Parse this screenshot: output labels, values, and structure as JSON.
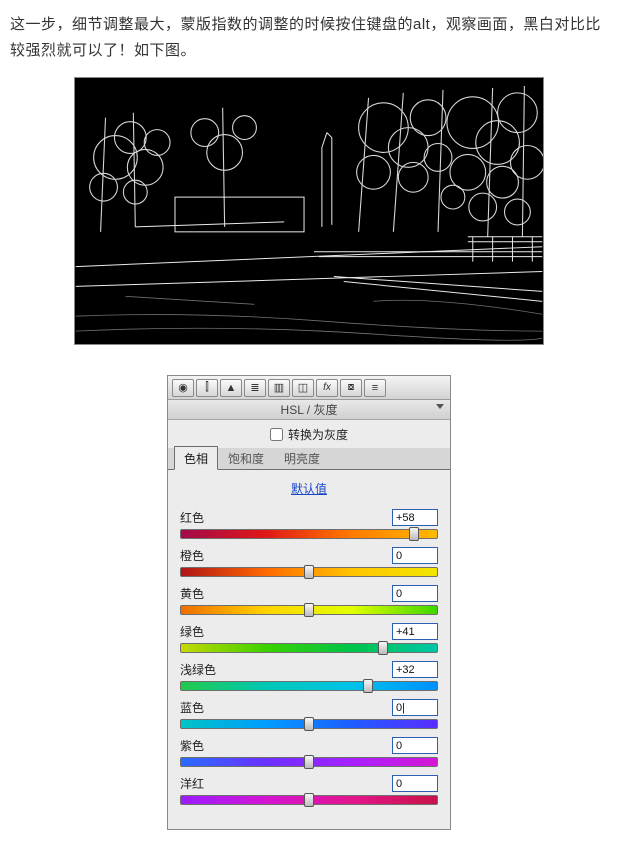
{
  "intro_text": "这一步，细节调整最大，蒙版指数的调整的时候按住键盘的alt，观察画面，黑白对比比较强烈就可以了！如下图。",
  "panel": {
    "title": "HSL / 灰度",
    "grayscale_label": "转换为灰度",
    "tabs": {
      "hue": "色相",
      "saturation": "饱和度",
      "luminance": "明亮度"
    },
    "default_link": "默认值",
    "toolbar_icons": [
      "aperture",
      "histogram",
      "triangle",
      "lines",
      "split",
      "crop",
      "fx",
      "camera",
      "sliders"
    ],
    "sliders": [
      {
        "label": "红色",
        "value": "+58",
        "grad": "g-red",
        "thumb_pct": 91
      },
      {
        "label": "橙色",
        "value": "0",
        "grad": "g-orange",
        "thumb_pct": 50
      },
      {
        "label": "黄色",
        "value": "0",
        "grad": "g-yellow",
        "thumb_pct": 50
      },
      {
        "label": "绿色",
        "value": "+41",
        "grad": "g-green",
        "thumb_pct": 79
      },
      {
        "label": "浅绿色",
        "value": "+32",
        "grad": "g-aqua",
        "thumb_pct": 73
      },
      {
        "label": "蓝色",
        "value": "0|",
        "grad": "g-blue",
        "thumb_pct": 50
      },
      {
        "label": "紫色",
        "value": "0",
        "grad": "g-purple",
        "thumb_pct": 50
      },
      {
        "label": "洋红",
        "value": "0",
        "grad": "g-magenta",
        "thumb_pct": 50
      }
    ]
  }
}
